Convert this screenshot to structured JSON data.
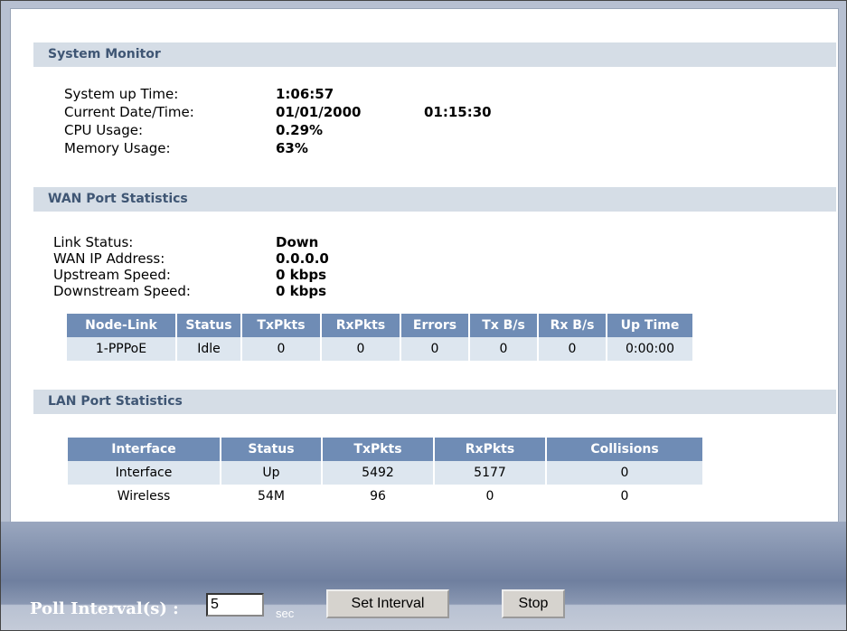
{
  "system_monitor": {
    "title": "System Monitor",
    "rows": [
      {
        "label": "System up Time:",
        "value": "1:06:57",
        "value2": ""
      },
      {
        "label": "Current Date/Time:",
        "value": "01/01/2000",
        "value2": "01:15:30"
      },
      {
        "label": "CPU Usage:",
        "value": "0.29%",
        "value2": ""
      },
      {
        "label": "Memory Usage:",
        "value": "63%",
        "value2": ""
      }
    ]
  },
  "wan": {
    "title": "WAN Port Statistics",
    "rows": [
      {
        "label": "Link Status:",
        "value": "Down"
      },
      {
        "label": "WAN IP Address:",
        "value": "0.0.0.0"
      },
      {
        "label": "Upstream Speed:",
        "value": "0 kbps"
      },
      {
        "label": "Downstream Speed:",
        "value": "0 kbps"
      }
    ],
    "table": {
      "headers": [
        "Node-Link",
        "Status",
        "TxPkts",
        "RxPkts",
        "Errors",
        "Tx B/s",
        "Rx B/s",
        "Up Time"
      ],
      "rows": [
        [
          "1-PPPoE",
          "Idle",
          "0",
          "0",
          "0",
          "0",
          "0",
          "0:00:00"
        ]
      ]
    }
  },
  "lan": {
    "title": "LAN Port Statistics",
    "table": {
      "headers": [
        "Interface",
        "Status",
        "TxPkts",
        "RxPkts",
        "Collisions"
      ],
      "rows": [
        [
          "Interface",
          "Up",
          "5492",
          "5177",
          "0"
        ],
        [
          "Wireless",
          "54M",
          "96",
          "0",
          "0"
        ]
      ]
    }
  },
  "footer": {
    "poll_label": "Poll Interval(s) :",
    "poll_value": "5",
    "unit": "sec",
    "set_button": "Set Interval",
    "stop_button": "Stop"
  }
}
